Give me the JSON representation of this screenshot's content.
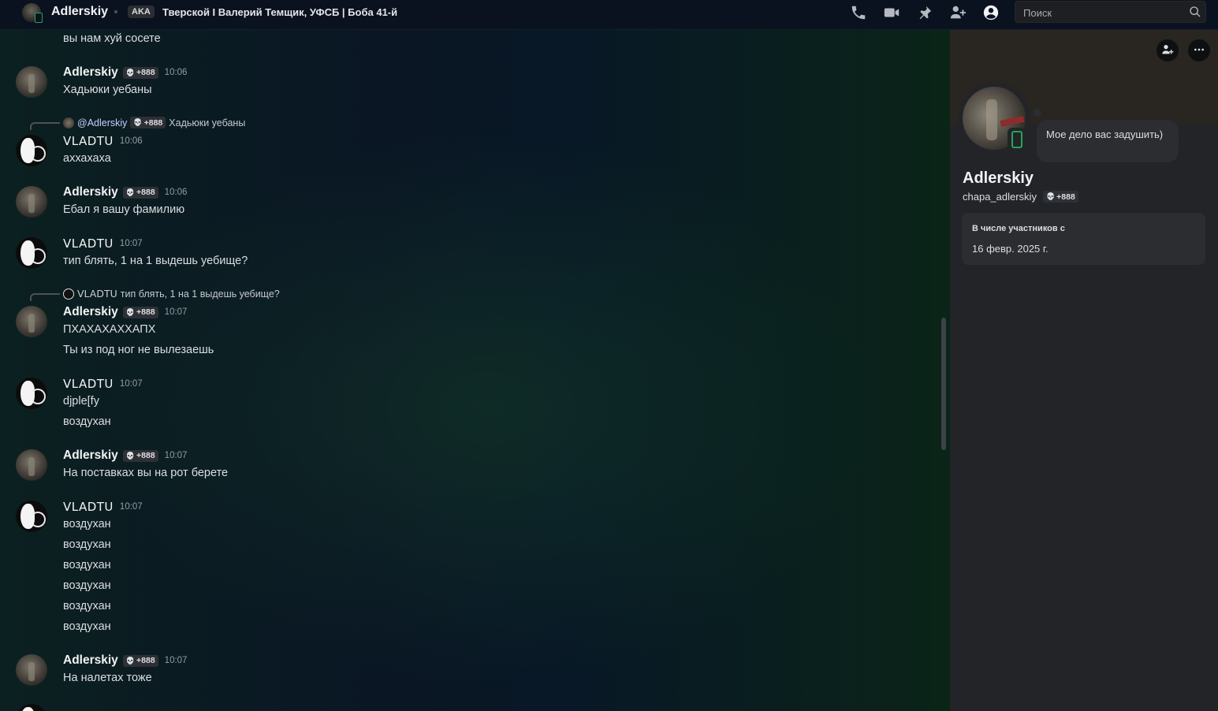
{
  "topbar": {
    "username": "Adlerskiy",
    "aka_label": "AKA",
    "aka_text": "Тверской I Валерий Темщик, УФСБ | Боба 41-й",
    "search_placeholder": "Поиск"
  },
  "messages": [
    {
      "type": "text",
      "text": "вы нам хуй сосете"
    },
    {
      "type": "group",
      "user": "Adlerskiy",
      "badge": "+888",
      "time": "10:06",
      "lines": [
        "Хадьюки уебаны"
      ]
    },
    {
      "type": "group",
      "user": "VLADTU",
      "time": "10:06",
      "reply": {
        "name": "@Adlerskiy",
        "badge": "+888",
        "text": "Хадьюки уебаны"
      },
      "lines": [
        "аххахаха"
      ]
    },
    {
      "type": "group",
      "user": "Adlerskiy",
      "badge": "+888",
      "time": "10:06",
      "lines": [
        "Ебал я вашу фамилию"
      ]
    },
    {
      "type": "group",
      "user": "VLADTU",
      "time": "10:07",
      "lines": [
        "тип блять, 1 на 1 выдешь уебище?"
      ]
    },
    {
      "type": "group",
      "user": "Adlerskiy",
      "badge": "+888",
      "time": "10:07",
      "reply": {
        "name": "VLADTU",
        "text": "тип блять, 1 на 1 выдешь уебище?"
      },
      "lines": [
        "ПХАХАХАХХАПХ",
        "Ты из под ног не вылезаешь"
      ]
    },
    {
      "type": "group",
      "user": "VLADTU",
      "time": "10:07",
      "lines": [
        "djple[fy",
        "воздухан"
      ]
    },
    {
      "type": "group",
      "user": "Adlerskiy",
      "badge": "+888",
      "time": "10:07",
      "lines": [
        "На поставках вы на рот берете"
      ]
    },
    {
      "type": "group",
      "user": "VLADTU",
      "time": "10:07",
      "lines": [
        "воздухан",
        "воздухан",
        "воздухан",
        "воздухан",
        "воздухан",
        "воздухан"
      ]
    },
    {
      "type": "group",
      "user": "Adlerskiy",
      "badge": "+888",
      "time": "10:07",
      "lines": [
        "На налетах тоже"
      ]
    }
  ],
  "profile": {
    "display_name": "Adlerskiy",
    "username": "chapa_adlerskiy",
    "badge": "+888",
    "status_text": "Мое дело вас задушить)",
    "member_since_label": "В числе участников с",
    "member_since_date": "16 февр. 2025 г."
  },
  "colors": {
    "accent_online": "#23a55a",
    "panel_bg": "#232428",
    "card_bg": "#2b2d31"
  },
  "icons": [
    "phone-call-icon",
    "video-call-icon",
    "pin-icon",
    "add-friend-icon",
    "profile-icon",
    "search-icon",
    "more-icon"
  ]
}
